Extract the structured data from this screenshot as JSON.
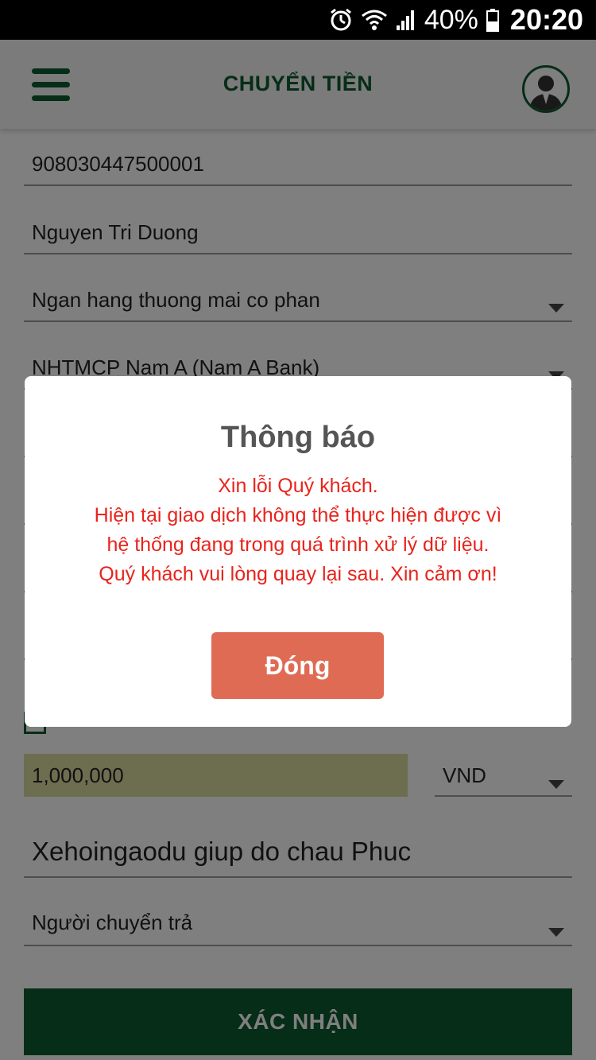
{
  "status_bar": {
    "battery": "40%",
    "time": "20:20",
    "icons": [
      "alarm-icon",
      "wifi-icon",
      "signal-icon",
      "battery-icon"
    ]
  },
  "header": {
    "title": "CHUYỂN TIỀN",
    "menu_icon": "hamburger-menu-icon",
    "avatar_icon": "user-avatar-icon"
  },
  "form": {
    "account_number": "908030447500001",
    "beneficiary_name": "Nguyen Tri Duong",
    "bank_type": "Ngan hang thuong mai co phan",
    "bank_name": "NHTMCP Nam A (Nam A Bank)",
    "amount": "1,000,000",
    "currency": "VND",
    "memo": "Xehoingaodu giup do chau Phuc",
    "fee_payer": "Người chuyển trả",
    "confirm_label": "XÁC NHẬN"
  },
  "dialog": {
    "title": "Thông báo",
    "message_lines": [
      "Xin lỗi Quý khách.",
      "Hiện tại giao dịch không thể thực hiện được vì",
      "hệ thống đang trong quá trình xử lý dữ liệu.",
      "Quý khách vui lòng quay lại sau. Xin cảm ơn!"
    ],
    "close_label": "Đóng"
  },
  "colors": {
    "brand_green": "#0c5a2e",
    "error_red": "#e8241c",
    "close_button": "#e06b55",
    "amount_bg": "#dadba0"
  }
}
